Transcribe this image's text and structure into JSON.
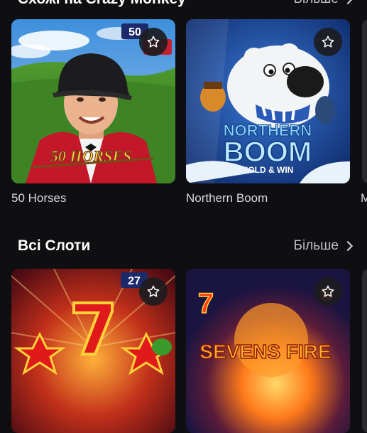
{
  "similar_section": {
    "title": "Схожі на Crazy Monkey",
    "more_label": "Більше",
    "games": [
      {
        "name": "50 Horses",
        "badge": "50",
        "logo_text": "50 HORSES"
      },
      {
        "name": "Northern Boom",
        "logo_line1": "NORTHERN",
        "logo_line2": "BOOM",
        "logo_line3": "HOLD & WIN"
      }
    ],
    "peek_name": "M"
  },
  "all_slots_section": {
    "title": "Всі Слоти",
    "more_label": "Більше",
    "games": [
      {
        "badge": "27"
      },
      {
        "badge": "7",
        "logo_text": "SEVENS FIRE"
      }
    ]
  },
  "colors": {
    "background": "#0f0f12",
    "text_primary": "#ffffff",
    "text_secondary": "#bfc0c6",
    "fav_button_bg": "#1c1c20"
  },
  "icons": {
    "favorite": "star-outline-icon",
    "more": "chevron-right-icon"
  }
}
